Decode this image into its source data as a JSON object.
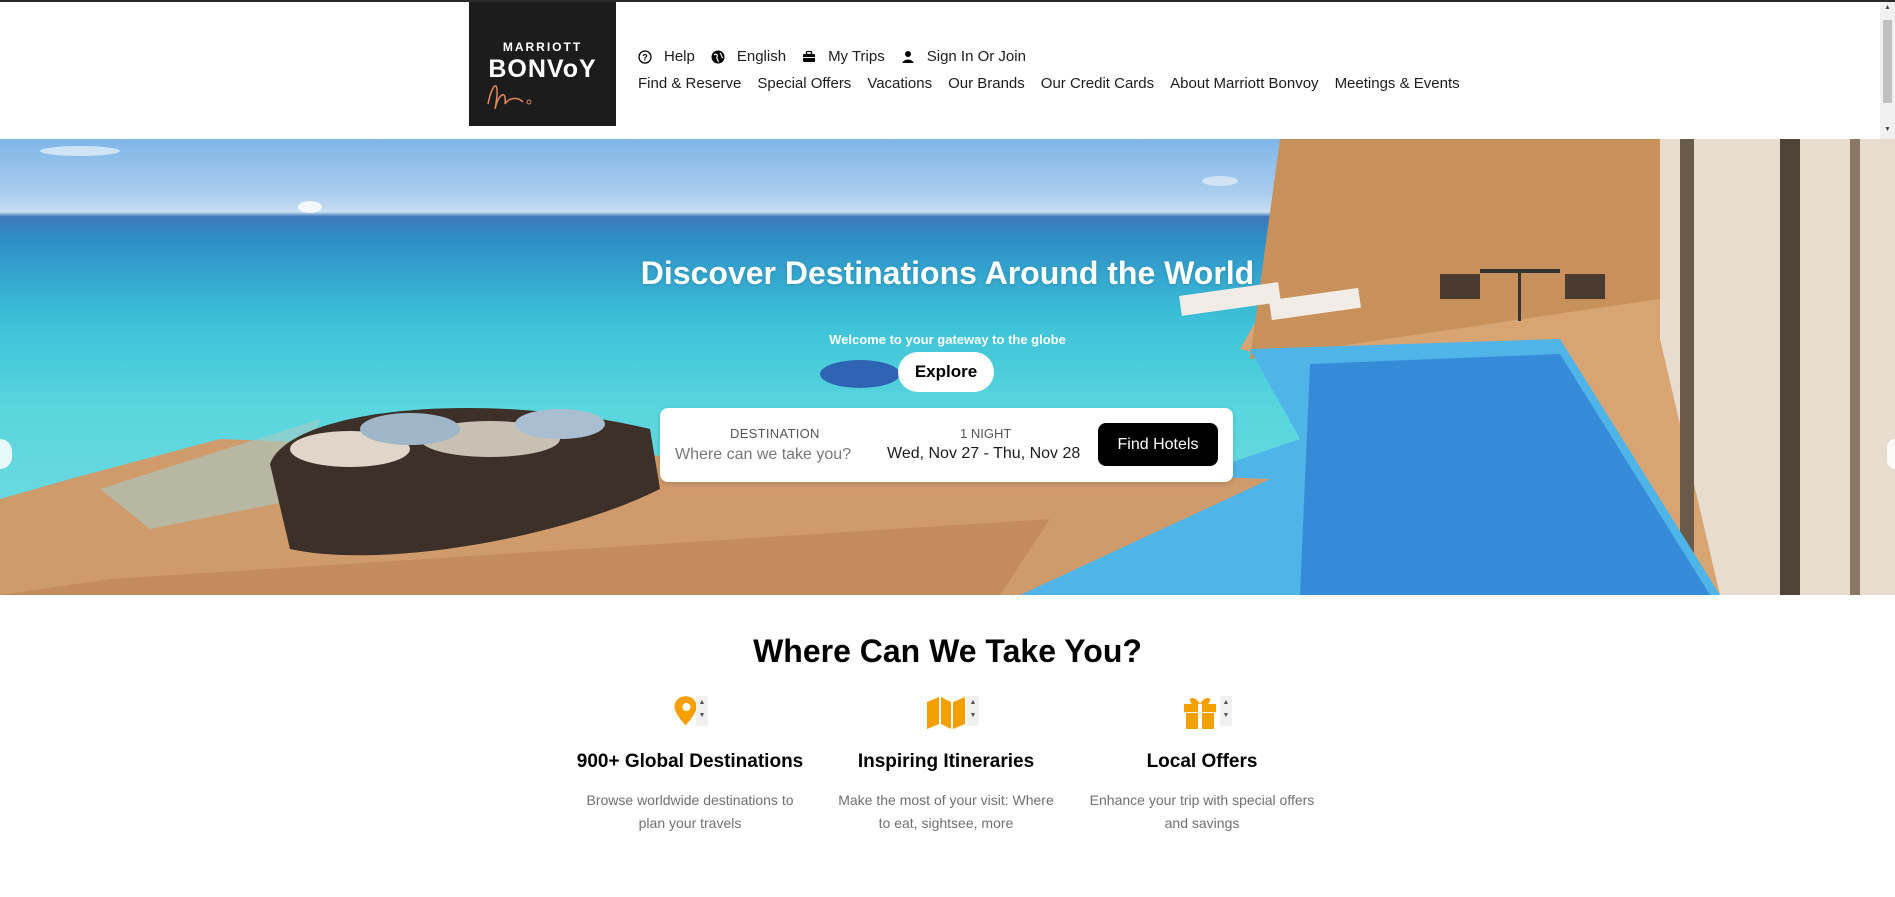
{
  "header": {
    "logo": {
      "line1": "MARRIOTT",
      "line2": "BONVoY"
    },
    "utility_nav": [
      {
        "icon": "help-icon",
        "label": "Help"
      },
      {
        "icon": "globe-icon",
        "label": "English"
      },
      {
        "icon": "briefcase-icon",
        "label": "My Trips"
      },
      {
        "icon": "user-icon",
        "label": "Sign In Or Join"
      }
    ],
    "main_nav": [
      "Find & Reserve",
      "Special Offers",
      "Vacations",
      "Our Brands",
      "Our Credit Cards",
      "About Marriott Bonvoy",
      "Meetings & Events"
    ]
  },
  "hero": {
    "title": "Discover Destinations Around the World",
    "subtitle": "Welcome to your gateway to the globe",
    "explore_label": "Explore",
    "search": {
      "destination_label": "DESTINATION",
      "destination_placeholder": "Where can we take you?",
      "nights_label": "1 NIGHT",
      "dates": "Wed, Nov 27 - Thu, Nov 28",
      "find_label": "Find Hotels"
    }
  },
  "features_section": {
    "title": "Where Can We Take You?",
    "items": [
      {
        "icon": "map-pin-icon",
        "title": "900+ Global Destinations",
        "desc": "Browse worldwide destinations to plan your travels"
      },
      {
        "icon": "map-icon",
        "title": "Inspiring Itineraries",
        "desc": "Make the most of your visit: Where to eat, sightsee, more"
      },
      {
        "icon": "gift-icon",
        "title": "Local Offers",
        "desc": "Enhance your trip with special offers and savings"
      }
    ]
  },
  "colors": {
    "accent": "#f5a000",
    "logo_bg": "#1c1c1c",
    "button_bg": "#000000"
  }
}
